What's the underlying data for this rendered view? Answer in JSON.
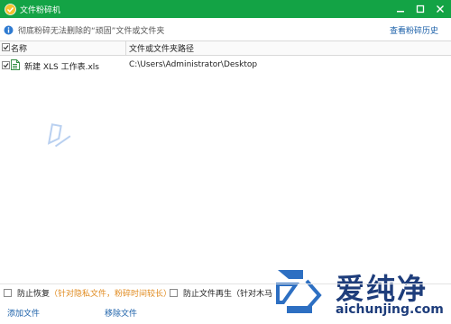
{
  "window": {
    "title": "文件粉碎机",
    "accent_color": "#13a345"
  },
  "info": {
    "text": "彻底粉碎无法删除的“顽固”文件或文件夹",
    "history_link": "查看粉碎历史"
  },
  "table": {
    "columns": [
      "名称",
      "文件或文件夹路径"
    ],
    "rows": [
      {
        "checked": true,
        "name": "新建 XLS 工作表.xls",
        "path": "C:\\Users\\Administrator\\Desktop"
      }
    ]
  },
  "options": {
    "prevent_recovery": {
      "label": "防止恢复",
      "note": "（针对隐私文件，粉碎时间较长）",
      "checked": false
    },
    "prevent_regen": {
      "label": "防止文件再生（针对木马",
      "checked": false
    }
  },
  "actions": {
    "add_file": "添加文件",
    "remove_file": "移除文件"
  },
  "watermark": {
    "brand": "爱纯净",
    "domain": "aichunjing.com"
  }
}
